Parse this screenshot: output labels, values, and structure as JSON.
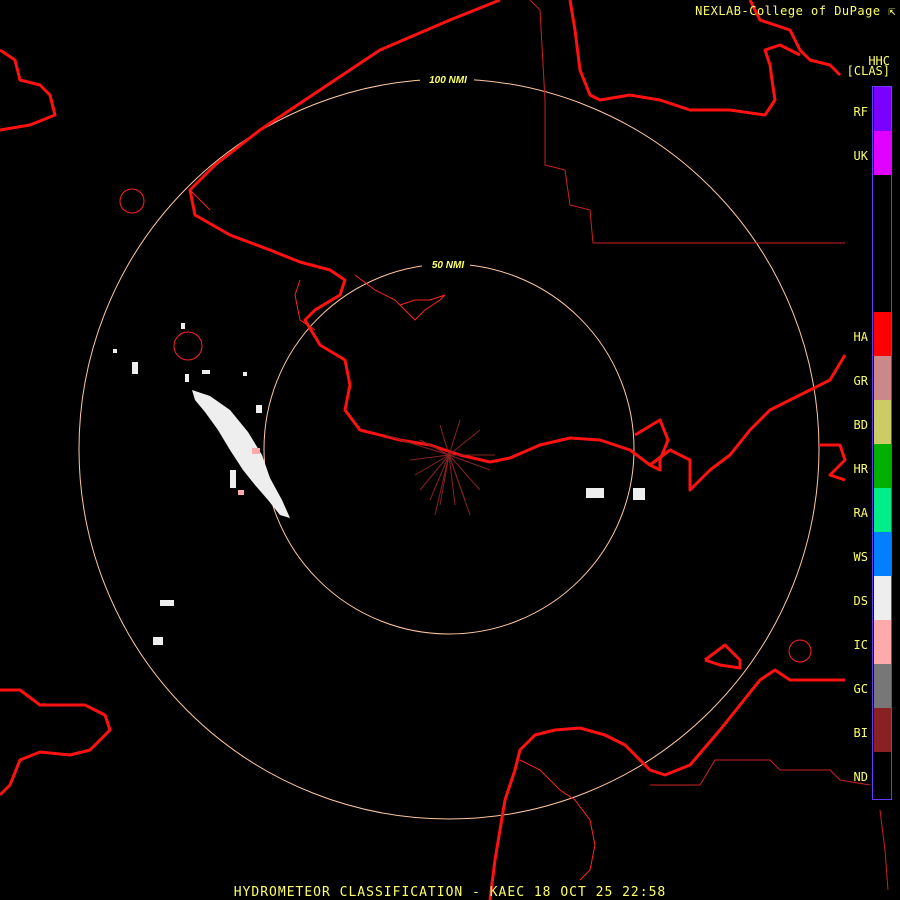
{
  "credit": "NEXLAB-College of DuPage",
  "product_name": "HHC",
  "product_code": "[CLAS]",
  "footer": "HYDROMETEOR CLASSIFICATION - KAEC 18 OCT 25 22:58",
  "range_rings": [
    {
      "label": "50 NMI"
    },
    {
      "label": "100 NMI"
    }
  ],
  "colors": {
    "coastline": "#ff1111",
    "border": "#cc2222",
    "rings": "#ffc8a0",
    "label": "#ffff66"
  },
  "legend": [
    {
      "code": "RF",
      "color": "#7a00ff"
    },
    {
      "code": "UK",
      "color": "#e000ff"
    },
    {
      "code": "HA",
      "color": "#ff0000"
    },
    {
      "code": "GR",
      "color": "#cc8888"
    },
    {
      "code": "BD",
      "color": "#cccc66"
    },
    {
      "code": "HR",
      "color": "#00b000"
    },
    {
      "code": "RA",
      "color": "#00ee88"
    },
    {
      "code": "WS",
      "color": "#0080ff"
    },
    {
      "code": "DS",
      "color": "#eeeeee"
    },
    {
      "code": "IC",
      "color": "#ffaaaa"
    },
    {
      "code": "GC",
      "color": "#777777"
    },
    {
      "code": "BI",
      "color": "#882222"
    },
    {
      "code": "ND",
      "color": "#000000"
    }
  ]
}
